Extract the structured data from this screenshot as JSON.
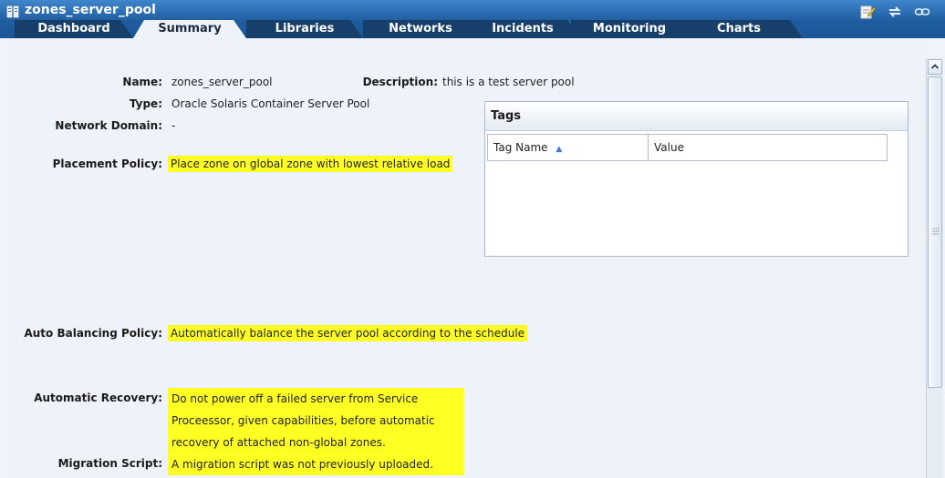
{
  "window": {
    "title": "zones_server_pool",
    "icons": [
      "server-pool-icon",
      "edit-icon",
      "refresh-icon",
      "link-icon"
    ]
  },
  "tabs": [
    {
      "label": "Dashboard",
      "active": false
    },
    {
      "label": "Summary",
      "active": true
    },
    {
      "label": "Libraries",
      "active": false
    },
    {
      "label": "Networks",
      "active": false
    },
    {
      "label": "Incidents",
      "active": false
    },
    {
      "label": "Monitoring",
      "active": false
    },
    {
      "label": "Charts",
      "active": false
    }
  ],
  "summary": {
    "name_label": "Name:",
    "name_value": "zones_server_pool",
    "type_label": "Type:",
    "type_value": "Oracle Solaris Container Server Pool",
    "network_domain_label": "Network Domain:",
    "network_domain_value": "-",
    "placement_policy_label": "Placement Policy:",
    "placement_policy_value": "Place zone on global zone with lowest relative load",
    "description_label": "Description:",
    "description_value": "this is a test server pool",
    "auto_balancing_label": "Auto Balancing Policy:",
    "auto_balancing_value": "Automatically balance the server pool according to the schedule",
    "automatic_recovery_label": "Automatic Recovery:",
    "automatic_recovery_lines": [
      "Do not power off a failed server from Service",
      "Proceessor, given capabilities, before automatic",
      "recovery of attached non-global zones."
    ],
    "migration_script_label": "Migration Script:",
    "migration_script_value": "A migration script was not previously uploaded."
  },
  "tags": {
    "title": "Tags",
    "columns": [
      "Tag Name",
      "Value"
    ],
    "sort_indicator": "▲",
    "rows": []
  },
  "colors": {
    "titlebar": "#2a6db5",
    "tab_inactive": "#163f6b",
    "content_bg": "#eef3fa",
    "highlight": "#ffff24"
  }
}
